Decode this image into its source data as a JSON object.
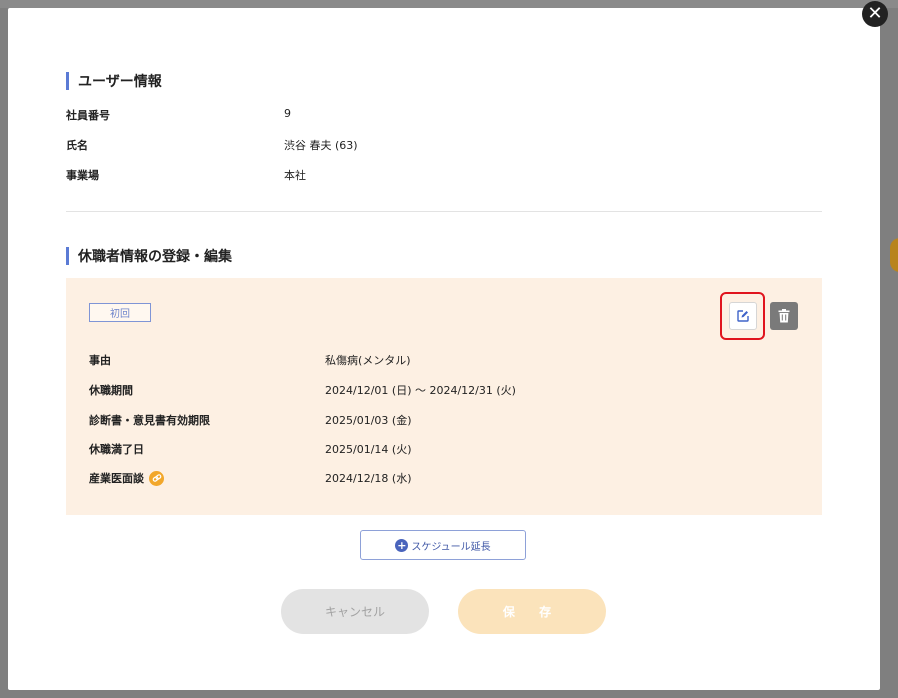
{
  "modal": {
    "close_icon": "close-icon"
  },
  "user_info": {
    "title": "ユーザー情報",
    "rows": [
      {
        "label": "社員番号",
        "value": "9"
      },
      {
        "label": "氏名",
        "value": "渋谷 春夫 (63)"
      },
      {
        "label": "事業場",
        "value": "本社"
      }
    ]
  },
  "leave_section": {
    "title": "休職者情報の登録・編集",
    "card": {
      "badge": "初回",
      "rows": [
        {
          "label": "事由",
          "value": "私傷病(メンタル)"
        },
        {
          "label": "休職期間",
          "value": "2024/12/01 (日) ～ 2024/12/31 (火)"
        },
        {
          "label": "診断書・意見書有効期限",
          "value": "2025/01/03 (金)"
        },
        {
          "label": "休職満了日",
          "value": "2025/01/14 (火)"
        },
        {
          "label": "産業医面談",
          "value": "2024/12/18 (水)"
        }
      ],
      "icons": {
        "edit": "edit-icon",
        "delete": "trash-icon",
        "link": "link-icon"
      }
    },
    "extend_button": "スケジュール延長"
  },
  "footer": {
    "cancel": "キャンセル",
    "save": "保 存"
  },
  "colors": {
    "accent": "#5b7bd5",
    "card_bg": "#fdf0e3",
    "highlight": "#e0141e",
    "save_bg": "#fbe3bb",
    "link_icon": "#f2a72a"
  }
}
